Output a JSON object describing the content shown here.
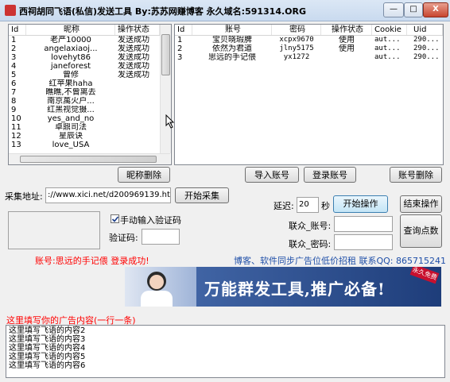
{
  "window": {
    "title": "西祠胡同飞语(私信)发送工具   By:苏苏网赚博客   永久域名:591314.ORG",
    "minimize": "—",
    "maximize": "□",
    "close": "X"
  },
  "left_list": {
    "headers": [
      "Id",
      "昵称",
      "操作状态"
    ],
    "rows": [
      {
        "id": "1",
        "nick": "老严10000",
        "status": "发送成功"
      },
      {
        "id": "2",
        "nick": "angelaxiaoj...",
        "status": "发送成功"
      },
      {
        "id": "3",
        "nick": "lovehyt86",
        "status": "发送成功"
      },
      {
        "id": "4",
        "nick": "janeforest",
        "status": "发送成功"
      },
      {
        "id": "5",
        "nick": "曾修",
        "status": "发送成功"
      },
      {
        "id": "6",
        "nick": "红苹果haha",
        "status": ""
      },
      {
        "id": "7",
        "nick": "瞧瞧,不曾离去",
        "status": ""
      },
      {
        "id": "8",
        "nick": "南京萬火户...",
        "status": ""
      },
      {
        "id": "9",
        "nick": "红黑视觉摄...",
        "status": ""
      },
      {
        "id": "10",
        "nick": "yes_and_no",
        "status": ""
      },
      {
        "id": "11",
        "nick": "卓鼎司法",
        "status": ""
      },
      {
        "id": "12",
        "nick": "星辰诀",
        "status": ""
      },
      {
        "id": "13",
        "nick": "love_USA",
        "status": ""
      }
    ]
  },
  "right_list": {
    "headers": [
      "Id",
      "账号",
      "密码",
      "操作状态",
      "Cookie",
      "Uid"
    ],
    "rows": [
      {
        "id": "1",
        "account": "宝贝晓瑕脾",
        "password": "xcpx9670",
        "status": "使用",
        "cookie": "aut...",
        "uid": "290..."
      },
      {
        "id": "2",
        "account": "依然为君道",
        "password": "jlny5175",
        "status": "使用",
        "cookie": "aut...",
        "uid": "290..."
      },
      {
        "id": "3",
        "account": "思远的手记偎",
        "password": "yx1272",
        "status": "",
        "cookie": "aut...",
        "uid": "290..."
      }
    ]
  },
  "buttons": {
    "delete_nick": "昵称删除",
    "import_account": "导入账号",
    "login_account": "登录账号",
    "delete_account": "账号删除",
    "start_collect": "开始采集",
    "start_operation": "开始操作",
    "end_operation": "结束操作",
    "query_points": "查询点数"
  },
  "collect": {
    "label": "采集地址:",
    "url": "://www.xici.net/d200969139.htm"
  },
  "delay": {
    "label": "延迟:",
    "value": "20",
    "unit": "秒"
  },
  "captcha": {
    "manual_checkbox_label": "手动输入验证码",
    "manual_checked": true,
    "code_label": "验证码:",
    "code_value": ""
  },
  "union": {
    "account_label": "联众_账号:",
    "password_label": "联众_密码:"
  },
  "status": {
    "login_message": "账号:思远的手记偎 登录成功!",
    "promo": "博客、软件同步广告位低价招租   联系QQ: 865715241"
  },
  "banner": {
    "headline": "万能群发工具,推广必备!",
    "badge": "永久免费"
  },
  "ad": {
    "label": "这里填写你的广告内容(一行一条)",
    "lines": [
      "这里填写飞语的内容2",
      "这里填写飞语的内容3",
      "这里填写飞语的内容4",
      "这里填写飞语的内容5",
      "这里填写飞语的内容6"
    ]
  },
  "colors": {
    "red_text": "#ff0000",
    "blue_text": "#1f4fa8",
    "banner_text": "#ffffff"
  }
}
